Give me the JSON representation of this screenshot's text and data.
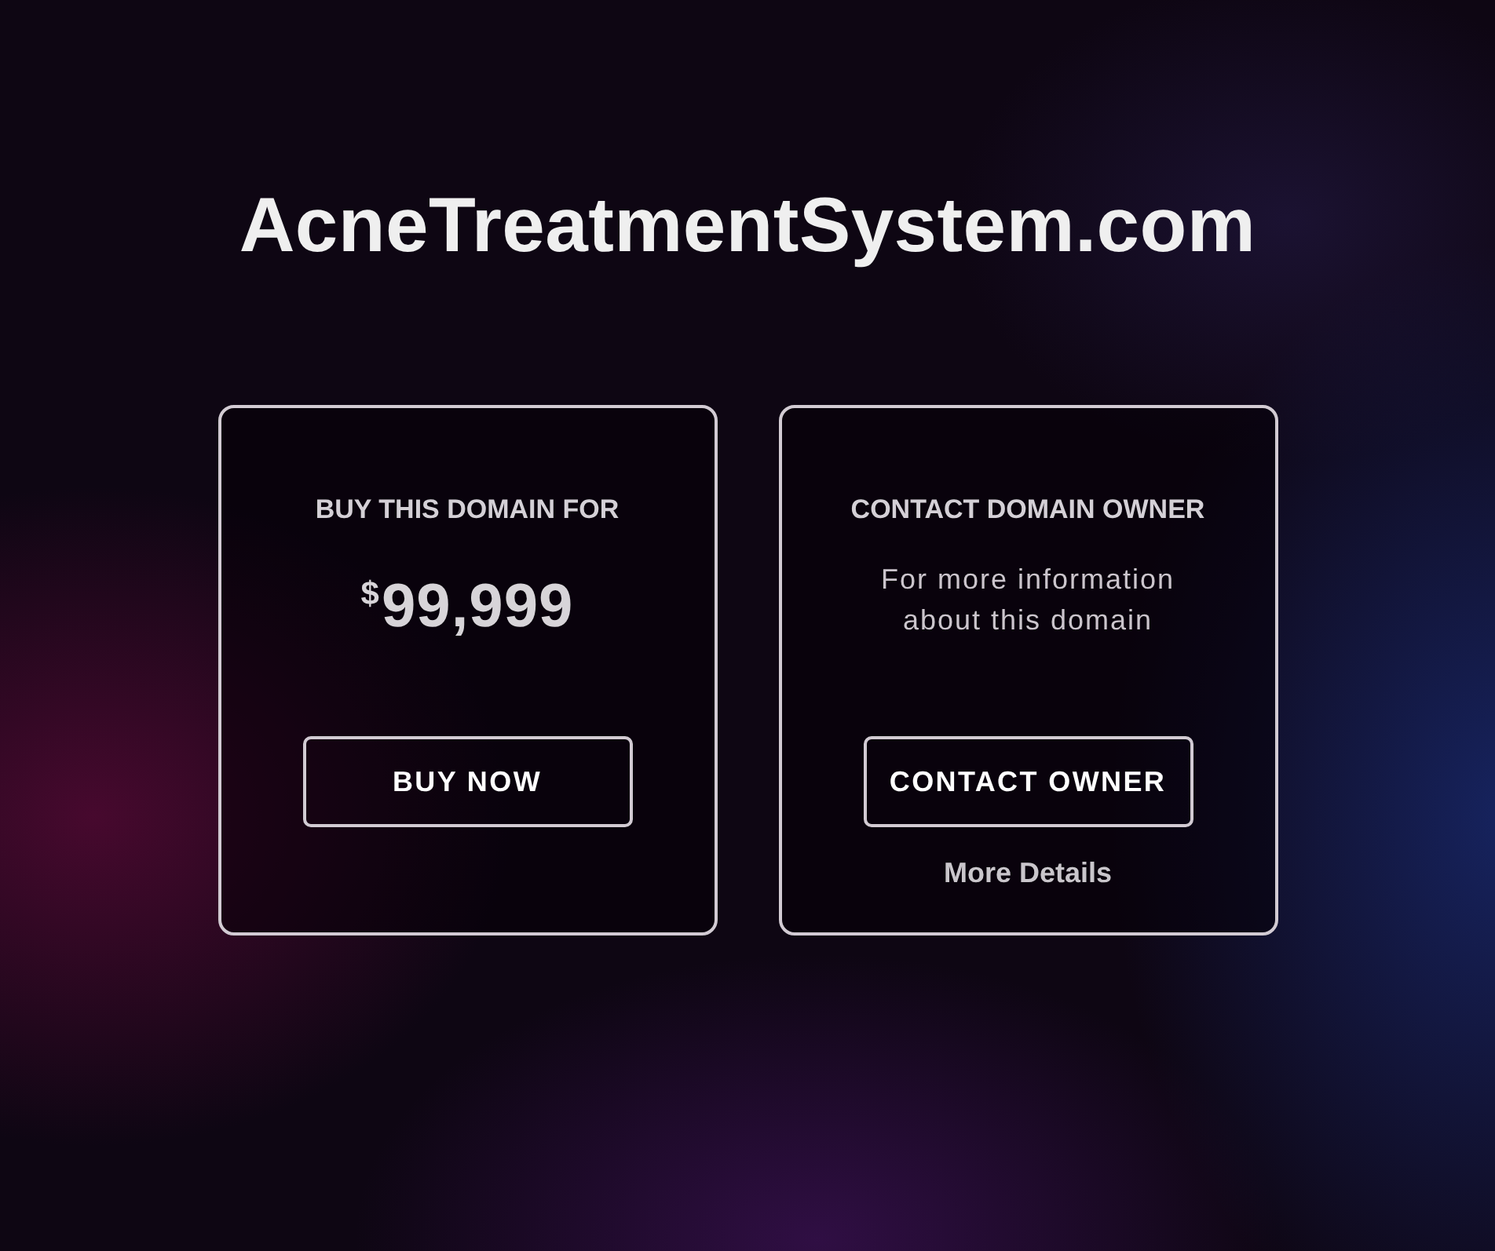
{
  "site": {
    "title": "AcneTreatmentSystem.com"
  },
  "cards": [
    {
      "kind": "buy",
      "heading": "BUY THIS DOMAIN FOR",
      "price": {
        "currency": "$",
        "amount": "99,999"
      },
      "button": "BUY NOW"
    },
    {
      "kind": "contact",
      "heading": "CONTACT DOMAIN OWNER",
      "description": "For more information about this domain",
      "button": "CONTACT OWNER",
      "link": "More Details"
    }
  ]
}
